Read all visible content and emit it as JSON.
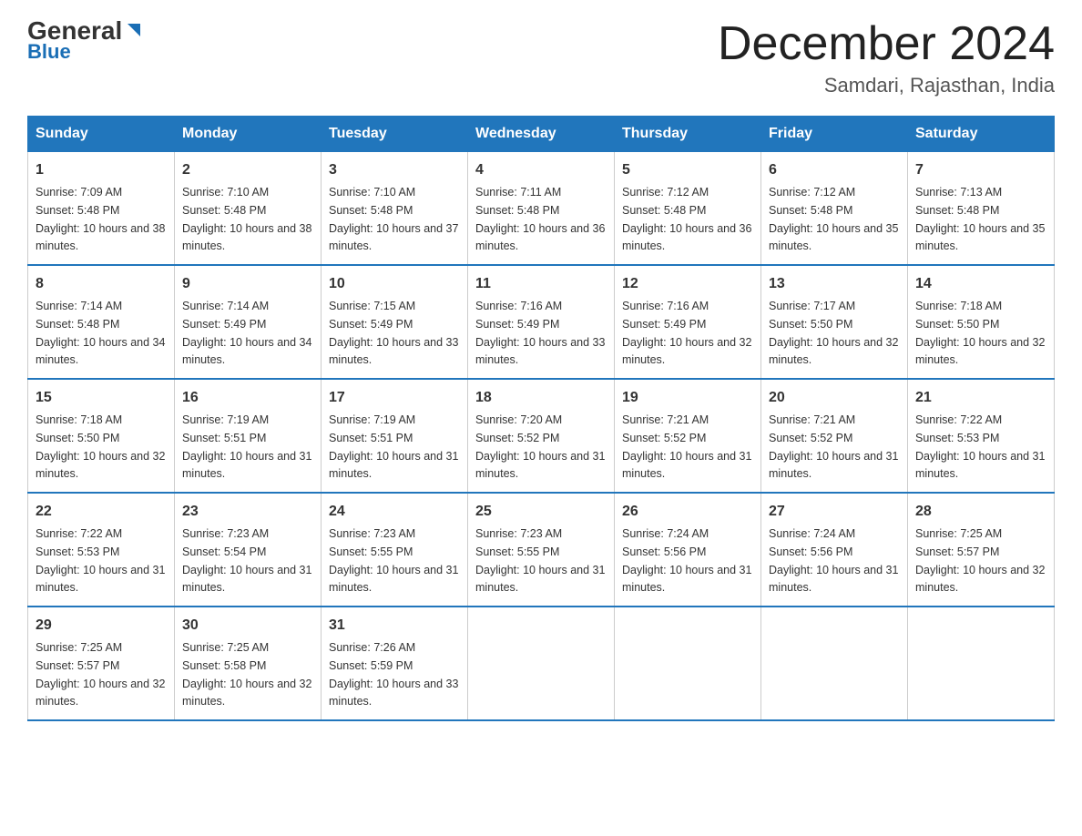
{
  "logo": {
    "general": "General",
    "blue": "Blue"
  },
  "header": {
    "month": "December 2024",
    "location": "Samdari, Rajasthan, India"
  },
  "days_of_week": [
    "Sunday",
    "Monday",
    "Tuesday",
    "Wednesday",
    "Thursday",
    "Friday",
    "Saturday"
  ],
  "weeks": [
    [
      {
        "day": "1",
        "sunrise": "7:09 AM",
        "sunset": "5:48 PM",
        "daylight": "10 hours and 38 minutes."
      },
      {
        "day": "2",
        "sunrise": "7:10 AM",
        "sunset": "5:48 PM",
        "daylight": "10 hours and 38 minutes."
      },
      {
        "day": "3",
        "sunrise": "7:10 AM",
        "sunset": "5:48 PM",
        "daylight": "10 hours and 37 minutes."
      },
      {
        "day": "4",
        "sunrise": "7:11 AM",
        "sunset": "5:48 PM",
        "daylight": "10 hours and 36 minutes."
      },
      {
        "day": "5",
        "sunrise": "7:12 AM",
        "sunset": "5:48 PM",
        "daylight": "10 hours and 36 minutes."
      },
      {
        "day": "6",
        "sunrise": "7:12 AM",
        "sunset": "5:48 PM",
        "daylight": "10 hours and 35 minutes."
      },
      {
        "day": "7",
        "sunrise": "7:13 AM",
        "sunset": "5:48 PM",
        "daylight": "10 hours and 35 minutes."
      }
    ],
    [
      {
        "day": "8",
        "sunrise": "7:14 AM",
        "sunset": "5:48 PM",
        "daylight": "10 hours and 34 minutes."
      },
      {
        "day": "9",
        "sunrise": "7:14 AM",
        "sunset": "5:49 PM",
        "daylight": "10 hours and 34 minutes."
      },
      {
        "day": "10",
        "sunrise": "7:15 AM",
        "sunset": "5:49 PM",
        "daylight": "10 hours and 33 minutes."
      },
      {
        "day": "11",
        "sunrise": "7:16 AM",
        "sunset": "5:49 PM",
        "daylight": "10 hours and 33 minutes."
      },
      {
        "day": "12",
        "sunrise": "7:16 AM",
        "sunset": "5:49 PM",
        "daylight": "10 hours and 32 minutes."
      },
      {
        "day": "13",
        "sunrise": "7:17 AM",
        "sunset": "5:50 PM",
        "daylight": "10 hours and 32 minutes."
      },
      {
        "day": "14",
        "sunrise": "7:18 AM",
        "sunset": "5:50 PM",
        "daylight": "10 hours and 32 minutes."
      }
    ],
    [
      {
        "day": "15",
        "sunrise": "7:18 AM",
        "sunset": "5:50 PM",
        "daylight": "10 hours and 32 minutes."
      },
      {
        "day": "16",
        "sunrise": "7:19 AM",
        "sunset": "5:51 PM",
        "daylight": "10 hours and 31 minutes."
      },
      {
        "day": "17",
        "sunrise": "7:19 AM",
        "sunset": "5:51 PM",
        "daylight": "10 hours and 31 minutes."
      },
      {
        "day": "18",
        "sunrise": "7:20 AM",
        "sunset": "5:52 PM",
        "daylight": "10 hours and 31 minutes."
      },
      {
        "day": "19",
        "sunrise": "7:21 AM",
        "sunset": "5:52 PM",
        "daylight": "10 hours and 31 minutes."
      },
      {
        "day": "20",
        "sunrise": "7:21 AM",
        "sunset": "5:52 PM",
        "daylight": "10 hours and 31 minutes."
      },
      {
        "day": "21",
        "sunrise": "7:22 AM",
        "sunset": "5:53 PM",
        "daylight": "10 hours and 31 minutes."
      }
    ],
    [
      {
        "day": "22",
        "sunrise": "7:22 AM",
        "sunset": "5:53 PM",
        "daylight": "10 hours and 31 minutes."
      },
      {
        "day": "23",
        "sunrise": "7:23 AM",
        "sunset": "5:54 PM",
        "daylight": "10 hours and 31 minutes."
      },
      {
        "day": "24",
        "sunrise": "7:23 AM",
        "sunset": "5:55 PM",
        "daylight": "10 hours and 31 minutes."
      },
      {
        "day": "25",
        "sunrise": "7:23 AM",
        "sunset": "5:55 PM",
        "daylight": "10 hours and 31 minutes."
      },
      {
        "day": "26",
        "sunrise": "7:24 AM",
        "sunset": "5:56 PM",
        "daylight": "10 hours and 31 minutes."
      },
      {
        "day": "27",
        "sunrise": "7:24 AM",
        "sunset": "5:56 PM",
        "daylight": "10 hours and 31 minutes."
      },
      {
        "day": "28",
        "sunrise": "7:25 AM",
        "sunset": "5:57 PM",
        "daylight": "10 hours and 32 minutes."
      }
    ],
    [
      {
        "day": "29",
        "sunrise": "7:25 AM",
        "sunset": "5:57 PM",
        "daylight": "10 hours and 32 minutes."
      },
      {
        "day": "30",
        "sunrise": "7:25 AM",
        "sunset": "5:58 PM",
        "daylight": "10 hours and 32 minutes."
      },
      {
        "day": "31",
        "sunrise": "7:26 AM",
        "sunset": "5:59 PM",
        "daylight": "10 hours and 33 minutes."
      },
      null,
      null,
      null,
      null
    ]
  ]
}
